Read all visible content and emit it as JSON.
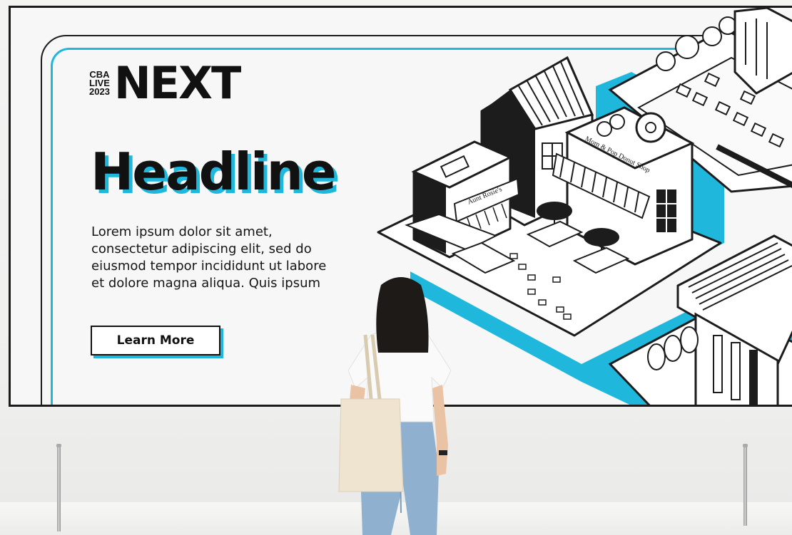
{
  "scene": {
    "accent_color": "#1fb8dc",
    "outline_color": "#1c1c1c"
  },
  "billboard": {
    "logo": {
      "small_lines": [
        "CBA",
        "LIVE",
        "2023"
      ],
      "big_text": "NEXT"
    },
    "headline": "Headline",
    "body": "Lorem ipsum dolor sit amet, consectetur adipiscing elit, sed do eiusmod tempor incididunt ut labore et dolore magna aliqua. Quis ipsum",
    "button_label": "Learn More",
    "illustration": {
      "shop_signs": [
        "Aunt Rosie's",
        "Mom & Pop Donut Shop"
      ]
    }
  }
}
